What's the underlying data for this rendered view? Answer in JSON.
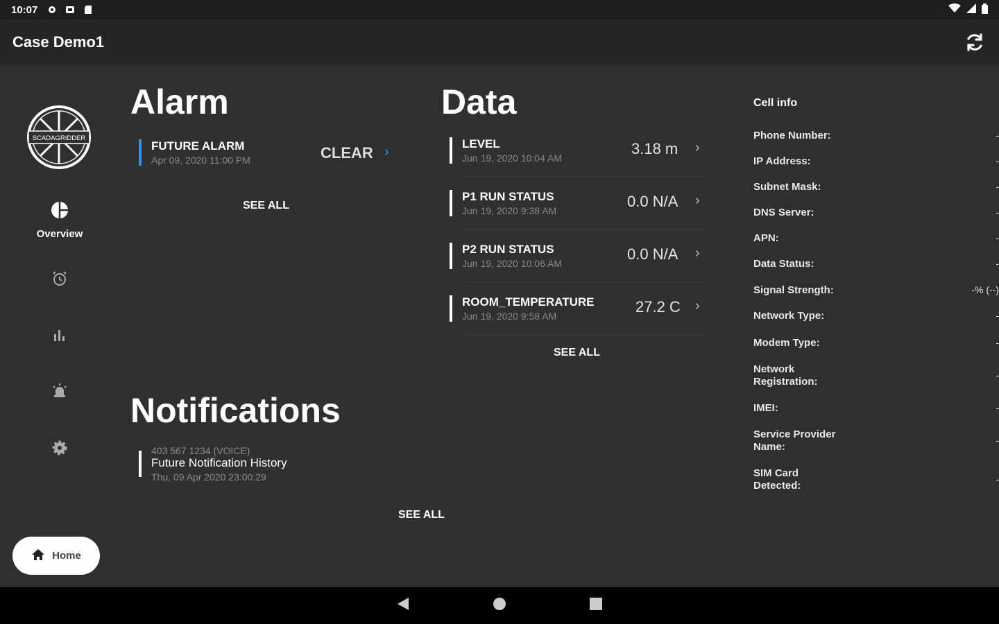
{
  "status": {
    "time": "10:07"
  },
  "app": {
    "title": "Case Demo1"
  },
  "nav": {
    "overview_label": "Overview",
    "home_label": "Home",
    "logo_text": "SCADAGRIDDER"
  },
  "alarm": {
    "title": "Alarm",
    "items": [
      {
        "name": "FUTURE ALARM",
        "date": "Apr 09, 2020 11:00 PM",
        "action": "CLEAR"
      }
    ],
    "see_all": "SEE ALL"
  },
  "data": {
    "title": "Data",
    "items": [
      {
        "name": "LEVEL",
        "date": "Jun 19, 2020 10:04 AM",
        "value": "3.18 m"
      },
      {
        "name": "P1 RUN STATUS",
        "date": "Jun 19, 2020 9:38 AM",
        "value": "0.0 N/A"
      },
      {
        "name": "P2 RUN STATUS",
        "date": "Jun 19, 2020 10:06 AM",
        "value": "0.0 N/A"
      },
      {
        "name": "ROOM_TEMPERATURE",
        "date": "Jun 19, 2020 9:58 AM",
        "value": "27.2 C"
      }
    ],
    "see_all": "SEE ALL"
  },
  "notifications": {
    "title": "Notifications",
    "items": [
      {
        "source": "403 567 1234 (VOICE)",
        "name": "Future Notification History",
        "date": "Thu, 09 Apr 2020 23:00:29"
      }
    ],
    "see_all": "SEE ALL"
  },
  "cell": {
    "title": "Cell info",
    "rows": [
      {
        "label": "Phone Number:",
        "value": "-"
      },
      {
        "label": "IP Address:",
        "value": "-"
      },
      {
        "label": "Subnet Mask:",
        "value": "-"
      },
      {
        "label": "DNS Server:",
        "value": "-"
      },
      {
        "label": "APN:",
        "value": "-"
      },
      {
        "label": "Data Status:",
        "value": "-"
      },
      {
        "label": "Signal Strength:",
        "value": "-% (--)"
      },
      {
        "label": "Network Type:",
        "value": "-"
      },
      {
        "label": "Modem Type:",
        "value": "-"
      },
      {
        "label": "Network Registration:",
        "value": "-"
      },
      {
        "label": "IMEI:",
        "value": "-"
      },
      {
        "label": "Service Provider Name:",
        "value": "-"
      },
      {
        "label": "SIM Card Detected:",
        "value": "-"
      }
    ]
  },
  "colors": {
    "accent": "#3b8fe0",
    "background": "#2f2f2f",
    "appbar": "#262626"
  }
}
